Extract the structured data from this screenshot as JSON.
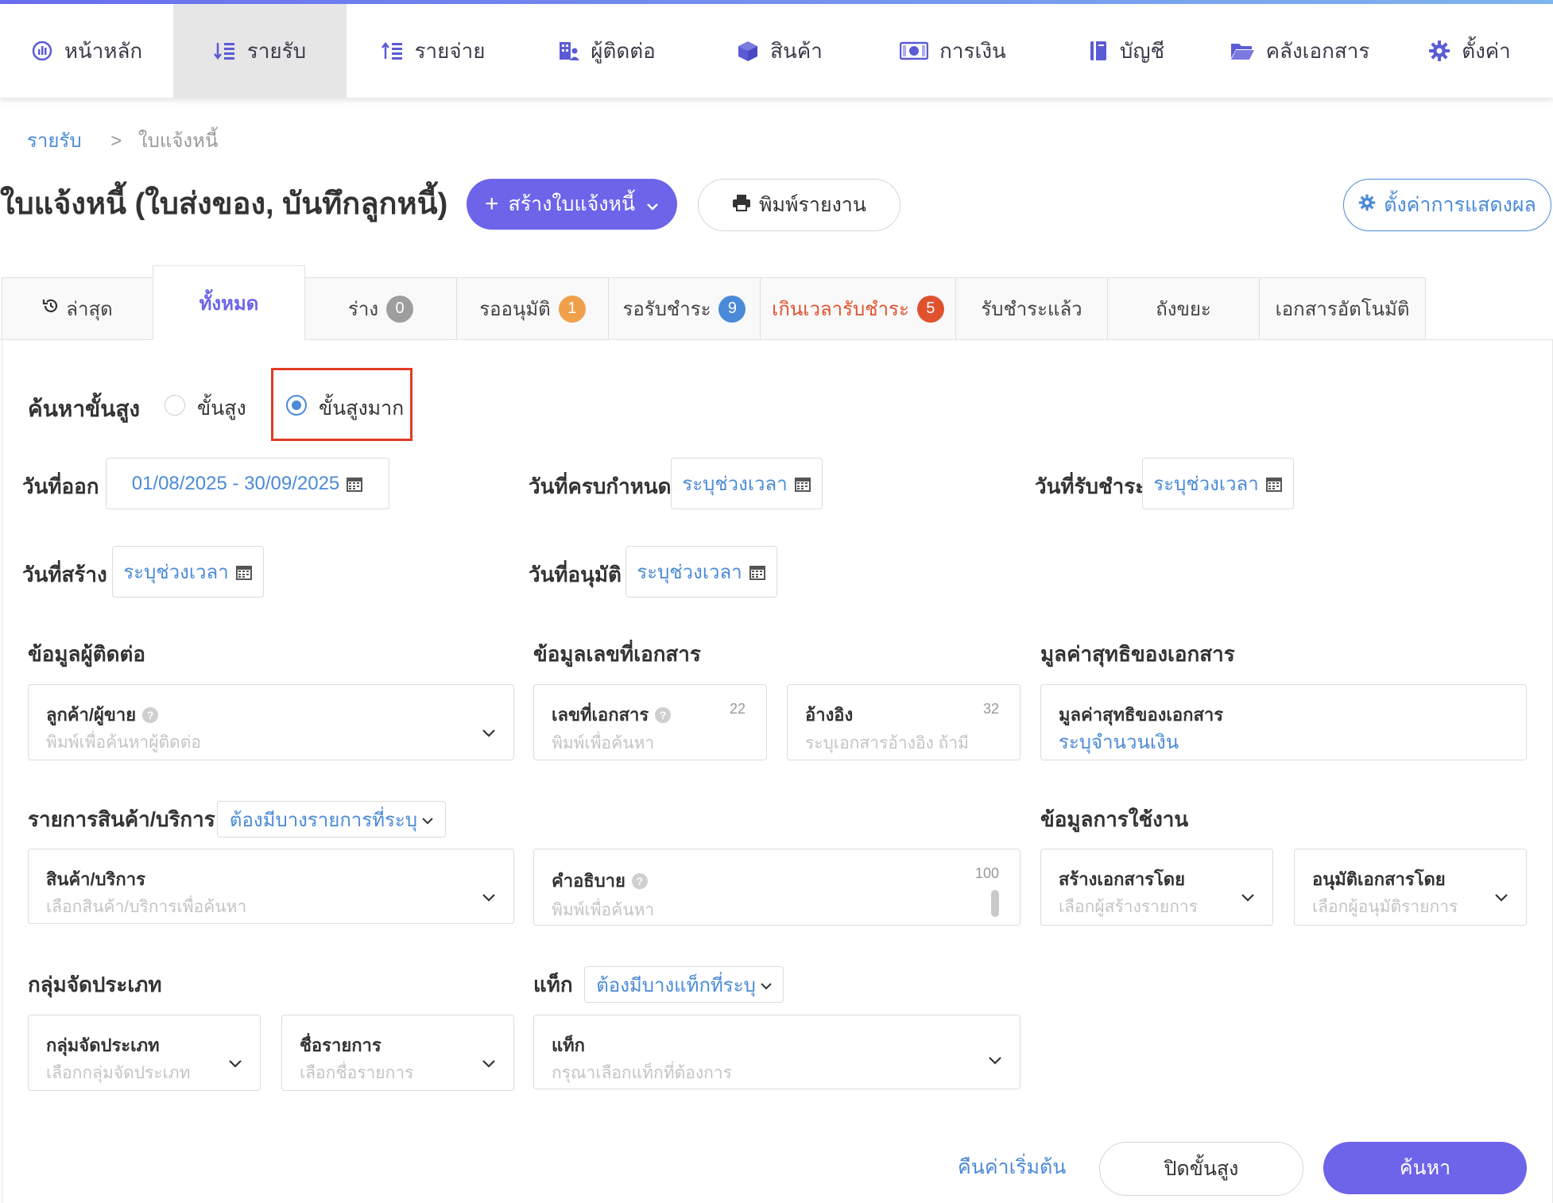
{
  "nav": {
    "items": [
      {
        "label": "หน้าหลัก",
        "icon": "dashboard-icon"
      },
      {
        "label": "รายรับ",
        "icon": "income-icon",
        "active": true
      },
      {
        "label": "รายจ่าย",
        "icon": "expense-icon"
      },
      {
        "label": "ผู้ติดต่อ",
        "icon": "contacts-icon"
      },
      {
        "label": "สินค้า",
        "icon": "product-box-icon"
      },
      {
        "label": "การเงิน",
        "icon": "money-icon"
      },
      {
        "label": "บัญชี",
        "icon": "accounting-book-icon"
      },
      {
        "label": "คลังเอกสาร",
        "icon": "folder-icon"
      },
      {
        "label": "ตั้งค่า",
        "icon": "gear-icon"
      }
    ]
  },
  "breadcrumb": {
    "parent": "รายรับ",
    "separator": ">",
    "current": "ใบแจ้งหนี้"
  },
  "header": {
    "title": "ใบแจ้งหนี้ (ใบส่งของ, บันทึกลูกหนี้)",
    "create_label": "สร้างใบแจ้งหนี้",
    "print_label": "พิมพ์รายงาน",
    "display_settings_label": "ตั้งค่าการแสดงผล"
  },
  "tabs": [
    {
      "label": "ล่าสุด"
    },
    {
      "label": "ทั้งหมด",
      "active": true
    },
    {
      "label": "ร่าง",
      "count": "0",
      "color": "#9e9e9e"
    },
    {
      "label": "รออนุมัติ",
      "count": "1",
      "color": "#f0a04b"
    },
    {
      "label": "รอรับชำระ",
      "count": "9",
      "color": "#4a8ad8"
    },
    {
      "label": "เกินเวลารับชำระ",
      "count": "5",
      "color": "#e0522e",
      "label_color": "#e0522e"
    },
    {
      "label": "รับชำระแล้ว"
    },
    {
      "label": "ถังขยะ"
    },
    {
      "label": "เอกสารอัตโนมัติ"
    }
  ],
  "search": {
    "title": "ค้นหาขั้นสูง",
    "mode_advanced": "ขั้นสูง",
    "mode_very_advanced": "ขั้นสูงมาก",
    "selected_mode": "ขั้นสูงมาก",
    "dates": {
      "issue_label": "วันที่ออก",
      "issue_value": "01/08/2025 - 30/09/2025",
      "due_label": "วันที่ครบกำหนด",
      "due_value": "ระบุช่วงเวลา",
      "paid_label": "วันที่รับชำระ",
      "paid_value": "ระบุช่วงเวลา",
      "created_label": "วันที่สร้าง",
      "created_value": "ระบุช่วงเวลา",
      "approved_label": "วันที่อนุมัติ",
      "approved_value": "ระบุช่วงเวลา"
    },
    "contact_section": "ข้อมูลผู้ติดต่อ",
    "contact_field_title": "ลูกค้า/ผู้ขาย",
    "contact_field_placeholder": "พิมพ์เพื่อค้นหาผู้ติดต่อ",
    "docno_section": "ข้อมูลเลขที่เอกสาร",
    "docno_field_title": "เลขที่เอกสาร",
    "docno_field_placeholder": "พิมพ์เพื่อค้นหา",
    "docno_limit": "22",
    "ref_field_title": "อ้างอิง",
    "ref_field_placeholder": "ระบุเอกสารอ้างอิง ถ้ามี",
    "ref_limit": "32",
    "net_section": "มูลค่าสุทธิของเอกสาร",
    "net_field_title": "มูลค่าสุทธิของเอกสาร",
    "net_field_value": "ระบุจำนวนเงิน",
    "product_section": "รายการสินค้า/บริการ",
    "product_filter": "ต้องมีบางรายการที่ระบุ",
    "product_field_title": "สินค้า/บริการ",
    "product_field_placeholder": "เลือกสินค้า/บริการเพื่อค้นหา",
    "desc_field_title": "คำอธิบาย",
    "desc_field_placeholder": "พิมพ์เพื่อค้นหา",
    "desc_limit": "100",
    "usage_section": "ข้อมูลการใช้งาน",
    "creator_field_title": "สร้างเอกสารโดย",
    "creator_field_placeholder": "เลือกผู้สร้างรายการ",
    "approver_field_title": "อนุมัติเอกสารโดย",
    "approver_field_placeholder": "เลือกผู้อนุมัติรายการ",
    "category_section": "กลุ่มจัดประเภท",
    "category_field_title": "กลุ่มจัดประเภท",
    "category_field_placeholder": "เลือกกลุ่มจัดประเภท",
    "item_name_field_title": "ชื่อรายการ",
    "item_name_field_placeholder": "เลือกชื่อรายการ",
    "tag_section": "แท็ก",
    "tag_filter": "ต้องมีบางแท็กที่ระบุ",
    "tag_field_title": "แท็ก",
    "tag_field_placeholder": "กรุณาเลือกแท็กที่ต้องการ"
  },
  "actions": {
    "reset_label": "คืนค่าเริ่มต้น",
    "close_label": "ปิดขั้นสูง",
    "search_label": "ค้นหา"
  },
  "colors": {
    "accent": "#6d64ea",
    "link": "#4a8ad8",
    "highlight": "#e03b24"
  }
}
